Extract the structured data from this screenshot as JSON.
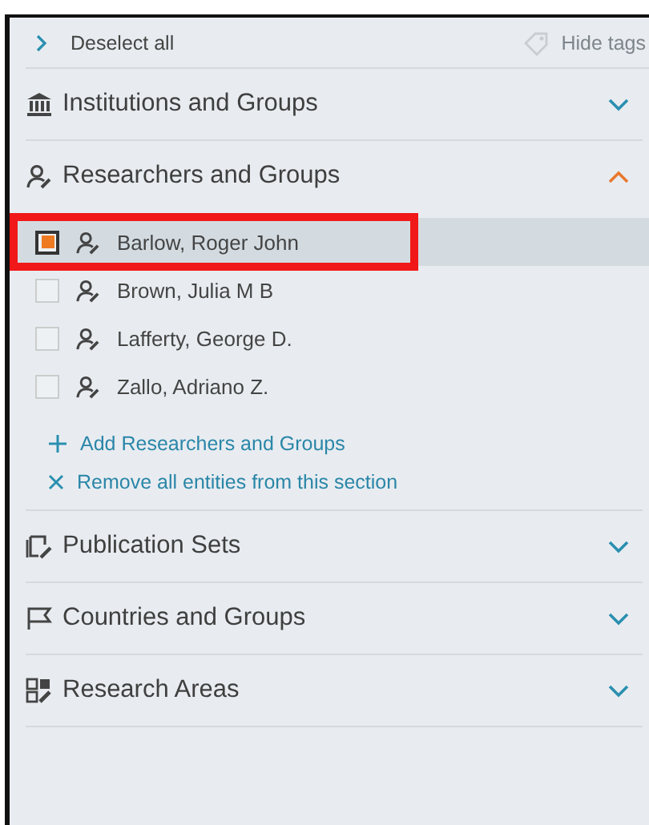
{
  "toolbar": {
    "deselect_label": "Deselect all",
    "hide_tags_label": "Hide tags",
    "hide_tags_disabled": true
  },
  "sections": [
    {
      "title": "Institutions and Groups",
      "kind": "institution",
      "expanded": false
    },
    {
      "title": "Researchers and Groups",
      "kind": "researcher",
      "expanded": true,
      "items": [
        {
          "name": "Barlow, Roger John",
          "checked": true,
          "selected": true,
          "highlighted": true
        },
        {
          "name": "Brown, Julia M B",
          "checked": false,
          "selected": false,
          "highlighted": false
        },
        {
          "name": "Lafferty, George D.",
          "checked": false,
          "selected": false,
          "highlighted": false
        },
        {
          "name": "Zallo, Adriano Z.",
          "checked": false,
          "selected": false,
          "highlighted": false
        }
      ],
      "actions": [
        {
          "kind": "add",
          "label": "Add Researchers and Groups"
        },
        {
          "kind": "remove",
          "label": "Remove all entities from this section"
        }
      ]
    },
    {
      "title": "Publication Sets",
      "kind": "publication",
      "expanded": false
    },
    {
      "title": "Countries and Groups",
      "kind": "country",
      "expanded": false
    },
    {
      "title": "Research Areas",
      "kind": "area",
      "expanded": false
    }
  ]
}
